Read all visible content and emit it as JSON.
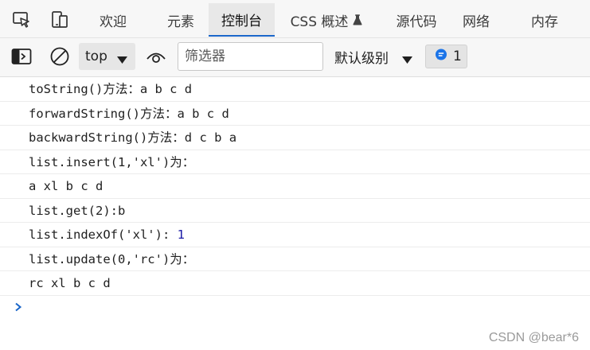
{
  "tabs": [
    {
      "label": "欢迎"
    },
    {
      "label": "元素"
    },
    {
      "label": "控制台"
    },
    {
      "label": "CSS 概述"
    },
    {
      "label": "源代码"
    },
    {
      "label": "网络"
    },
    {
      "label": "内存"
    }
  ],
  "active_tab": "控制台",
  "icons": {
    "inspect": "inspect-element-icon",
    "device": "device-emulation-icon",
    "flask": "experimental-flask-icon",
    "sidebar": "show-sidebar-icon",
    "clear": "clear-console-icon",
    "eye": "live-expression-eye-icon",
    "caret": "caret-down-icon",
    "issues": "message-bubble-icon",
    "prompt": "prompt-chevron-icon"
  },
  "toolbar": {
    "context": "top",
    "filter_placeholder": "筛选器",
    "level": "默认级别",
    "issues_count": "1"
  },
  "colors": {
    "accent": "#1a66c9",
    "issues_badge": "#1a73e8",
    "number": "#1a1aa6"
  },
  "console_lines": [
    {
      "text": "toString()方法：a b c d"
    },
    {
      "text": "forwardString()方法：a b c d"
    },
    {
      "text": "backwardString()方法：d c b a"
    },
    {
      "text": "list.insert(1,'xl')为："
    },
    {
      "text": "a xl b c d"
    },
    {
      "text": "list.get(2):b"
    },
    {
      "text": "list.indexOf('xl'): ",
      "number": "1"
    },
    {
      "text": "list.update(0,'rc')为："
    },
    {
      "text": "rc xl b c d"
    }
  ],
  "watermark": "CSDN @bear*6"
}
